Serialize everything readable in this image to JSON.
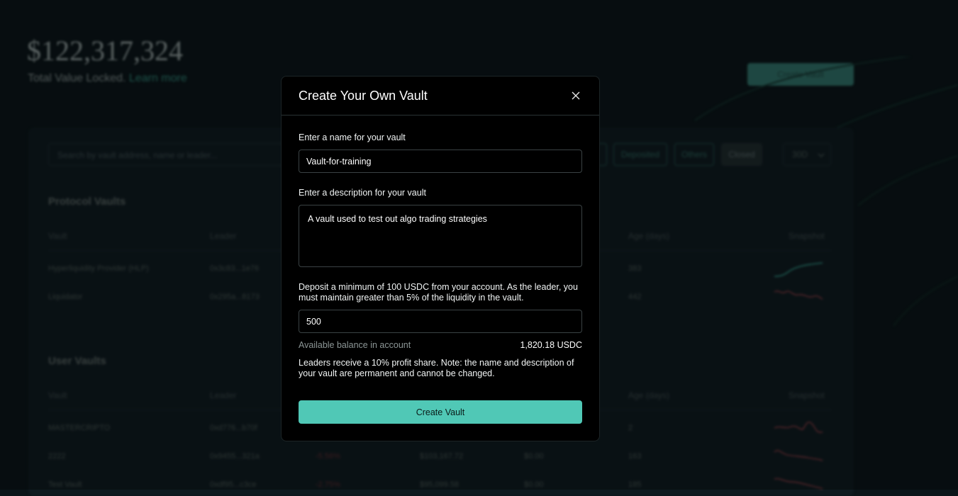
{
  "background": {
    "tvl_value": "$122,317,324",
    "tvl_label": "Total Value Locked.",
    "learn_more": "Learn more",
    "create_vault_top": "Create Vault",
    "search_placeholder": "Search by vault address, name or leader...",
    "filters": [
      "Deposited",
      "Others",
      "Closed"
    ],
    "days_select": "30D",
    "protocol_vaults": {
      "title": "Protocol Vaults",
      "headers": {
        "vault": "Vault",
        "leader": "Leader",
        "age": "Age (days)",
        "snapshot": "Snapshot"
      },
      "rows": [
        {
          "vault": "Hyperliquidity Provider (HLP)",
          "leader": "0x3c83...1e76",
          "age": "383"
        },
        {
          "vault": "Liquidator",
          "leader": "0x295a...8173",
          "age": "442"
        }
      ]
    },
    "user_vaults": {
      "title": "User Vaults",
      "headers": {
        "vault": "Vault",
        "leader": "Leader",
        "age": "Age (days)",
        "snapshot": "Snapshot"
      },
      "rows": [
        {
          "vault": "MASTERCRIPTO",
          "leader": "0xd776...b70f",
          "apr": "",
          "tvl": "",
          "deposit": "",
          "age": "2"
        },
        {
          "vault": "2222",
          "leader": "0x9455...321a",
          "apr": "-5.56%",
          "tvl": "$103,167.72",
          "deposit": "$0.00",
          "age": "163"
        },
        {
          "vault": "Test Vault",
          "leader": "0xdf95...c3ce",
          "apr": "-2.75%",
          "tvl": "$95,099.58",
          "deposit": "$0.00",
          "age": "185"
        }
      ]
    }
  },
  "modal": {
    "title": "Create Your Own Vault",
    "name_label": "Enter a name for your vault",
    "name_value": "Vault-for-training",
    "description_label": "Enter a description for your vault",
    "description_value": "A vault used to test out algo trading strategies",
    "deposit_label": "Deposit a minimum of 100 USDC from your account. As the leader, you must maintain greater than 5% of the liquidity in the vault.",
    "deposit_value": "500",
    "balance_label": "Available balance in account",
    "balance_value": "1,820.18 USDC",
    "note": "Leaders receive a 10% profit share. Note: the name and description of your vault are permanent and cannot be changed.",
    "submit_label": "Create Vault"
  },
  "colors": {
    "accent": "#50c8b6",
    "modal_bg": "#000000",
    "page_bg": "#0b1519",
    "positive": "#2f8f7f",
    "negative": "#8a3a40"
  },
  "icons": [
    "close-icon",
    "chevron-down-icon"
  ]
}
